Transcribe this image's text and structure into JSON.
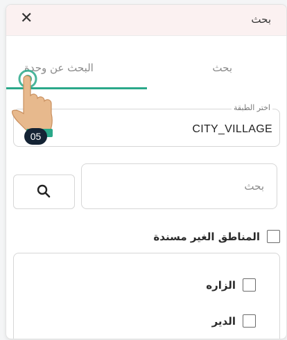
{
  "header": {
    "title": "بحث",
    "close_glyph": "✕"
  },
  "tabs": [
    {
      "label": "البحث عن وحدة",
      "active": true
    },
    {
      "label": "بحث",
      "active": false
    }
  ],
  "layer_field": {
    "legend": "اختر الطبقة",
    "value": "CITY_VILLAGE"
  },
  "search": {
    "placeholder": "بحث",
    "button_icon": "search-icon"
  },
  "unassigned": {
    "label": "المناطق الغير مسندة",
    "checked": false
  },
  "units": [
    {
      "label": "الزاره",
      "checked": false
    },
    {
      "label": "الدير",
      "checked": false
    }
  ],
  "tutorial": {
    "step": "05"
  },
  "colors": {
    "accent": "#2aa889",
    "header_bg": "#fbf1f1",
    "badge_bg": "#142334",
    "hand": "#e7b98d"
  }
}
